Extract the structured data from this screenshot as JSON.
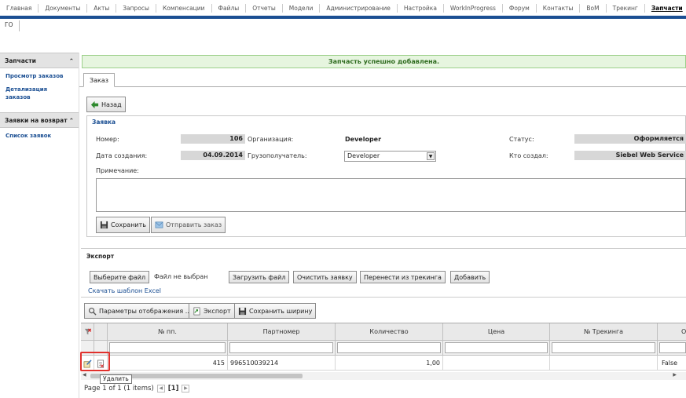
{
  "topnav": {
    "items": [
      "Главная",
      "Документы",
      "Акты",
      "Запросы",
      "Компенсации",
      "Файлы",
      "Отчеты",
      "Модели",
      "Администрирование",
      "Настройка",
      "WorkInProgress",
      "Форум",
      "Контакты",
      "BoM",
      "Трекинг"
    ],
    "active": "Запчасти"
  },
  "subnav": {
    "item": "ГО"
  },
  "sidebar": {
    "section1": {
      "title": "Запчасти",
      "items": [
        "Просмотр заказов",
        "Детализация заказов"
      ]
    },
    "section2": {
      "title": "Заявки на возврат",
      "items": [
        "Список заявок"
      ]
    }
  },
  "message": {
    "success": "Запчасть успешно добавлена."
  },
  "tab": {
    "label": "Заказ"
  },
  "order": {
    "back_label": "Назад",
    "legend": "Заявка",
    "number_label": "Номер:",
    "number": "106",
    "org_label": "Организация:",
    "org": "Developer",
    "status_label": "Статус:",
    "status": "Оформляется",
    "created_label": "Дата создания:",
    "created": "04.09.2014",
    "consignee_label": "Грузополучатель:",
    "consignee": "Developer",
    "creator_label": "Кто создал:",
    "creator": "Siebel Web Service",
    "note_label": "Примечание:",
    "save_label": "Сохранить",
    "send_label": "Отправить заказ"
  },
  "export": {
    "legend": "Экспорт",
    "choose_file": "Выберите файл",
    "no_file": "Файл не выбран",
    "upload": "Загрузить файл",
    "clear": "Очистить заявку",
    "from_tracking": "Перенести из трекинга",
    "add": "Добавить",
    "template_link": "Скачать шаблон Excel"
  },
  "grid_toolbar": {
    "params": "Параметры отображения ...",
    "export": "Экспорт",
    "save_width": "Сохранить ширину"
  },
  "grid": {
    "columns": [
      "№ пп.",
      "Партномер",
      "Количество",
      "Цена",
      "№ Трекинга",
      "От"
    ],
    "rows": [
      {
        "num": "415",
        "part": "996510039214",
        "qty": "1,00",
        "price": "",
        "tracking": "",
        "other": "False"
      }
    ]
  },
  "tooltip": {
    "delete": "Удалить"
  },
  "pager": {
    "text": "Page 1 of 1 (1 items)",
    "current": "[1]"
  },
  "colors": {
    "accent": "#1b4f93",
    "success_bg": "#e6f5df",
    "highlight": "#e0302c"
  }
}
